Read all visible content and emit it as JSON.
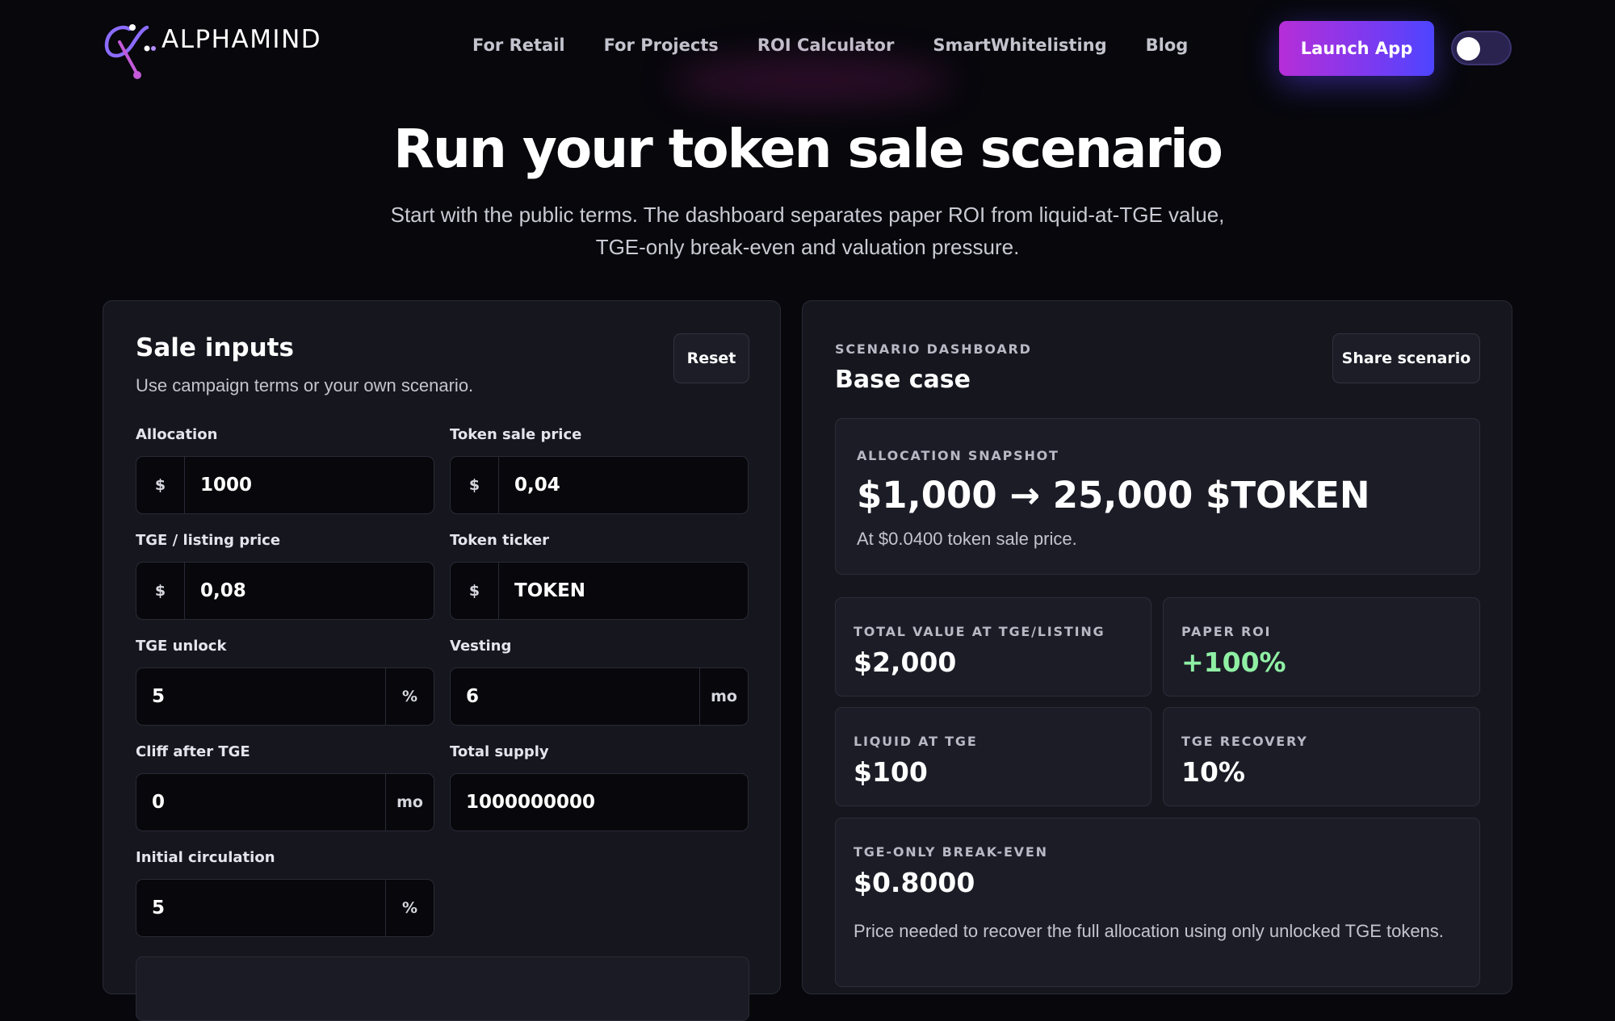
{
  "brand": {
    "name": "ALPHAMIND"
  },
  "nav": [
    {
      "label": "For Retail"
    },
    {
      "label": "For Projects"
    },
    {
      "label": "ROI Calculator"
    },
    {
      "label": "SmartWhitelisting"
    },
    {
      "label": "Blog"
    }
  ],
  "header": {
    "launch_label": "Launch App",
    "theme_toggle": "on"
  },
  "hero": {
    "title": "Run your token sale scenario",
    "subtitle": "Start with the public terms. The dashboard separates paper ROI from liquid-at-TGE value, TGE-only break-even and valuation pressure."
  },
  "inputs": {
    "title": "Sale inputs",
    "subtitle": "Use campaign terms or your own scenario.",
    "reset_label": "Reset",
    "fields": {
      "allocation": {
        "label": "Allocation",
        "prefix": "$",
        "value": "1000"
      },
      "sale_price": {
        "label": "Token sale price",
        "prefix": "$",
        "value": "0,04"
      },
      "tge_price": {
        "label": "TGE / listing price",
        "prefix": "$",
        "value": "0,08"
      },
      "ticker": {
        "label": "Token ticker",
        "prefix": "$",
        "value": "TOKEN"
      },
      "tge_unlock": {
        "label": "TGE unlock",
        "value": "5",
        "suffix": "%"
      },
      "vesting": {
        "label": "Vesting",
        "value": "6",
        "suffix": "mo"
      },
      "cliff": {
        "label": "Cliff after TGE",
        "value": "0",
        "suffix": "mo"
      },
      "total_supply": {
        "label": "Total supply",
        "value": "1000000000"
      },
      "initial_circulation": {
        "label": "Initial circulation",
        "value": "5",
        "suffix": "%"
      }
    }
  },
  "dashboard": {
    "eyebrow": "SCENARIO DASHBOARD",
    "title": "Base case",
    "share_label": "Share scenario",
    "snapshot": {
      "eyebrow": "ALLOCATION SNAPSHOT",
      "main": "$1,000 → 25,000 $TOKEN",
      "note": "At $0.0400 token sale price."
    },
    "metrics": {
      "total_value": {
        "label": "TOTAL VALUE AT TGE/LISTING",
        "value": "$2,000"
      },
      "paper_roi": {
        "label": "PAPER ROI",
        "value": "+100%"
      },
      "liquid": {
        "label": "LIQUID AT TGE",
        "value": "$100"
      },
      "recovery": {
        "label": "TGE RECOVERY",
        "value": "10%"
      },
      "breakeven": {
        "label": "TGE-ONLY BREAK-EVEN",
        "value": "$0.8000",
        "note": "Price needed to recover the full allocation using only unlocked TGE tokens."
      }
    }
  },
  "colors": {
    "background": "#07070c",
    "panel": "#16161f",
    "accent_gradient_start": "#b62ed8",
    "accent_gradient_end": "#4d45ff",
    "positive": "#8ff0a4"
  }
}
